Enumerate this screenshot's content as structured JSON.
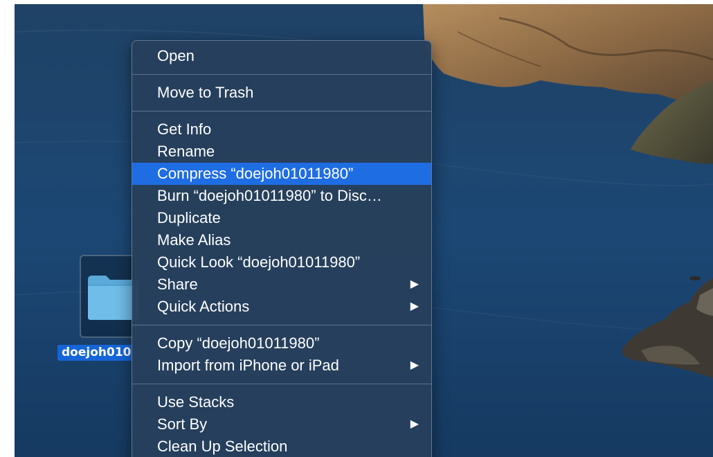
{
  "desktop": {
    "folder": {
      "label": "doejoh010",
      "icon": "folder-icon"
    }
  },
  "context_menu": {
    "groups": [
      {
        "items": [
          {
            "label": "Open"
          }
        ]
      },
      {
        "items": [
          {
            "label": "Move to Trash"
          }
        ]
      },
      {
        "items": [
          {
            "label": "Get Info"
          },
          {
            "label": "Rename"
          },
          {
            "label": "Compress “doejoh01011980”",
            "highlighted": true
          },
          {
            "label": "Burn “doejoh01011980” to Disc…"
          },
          {
            "label": "Duplicate"
          },
          {
            "label": "Make Alias"
          },
          {
            "label": "Quick Look “doejoh01011980”"
          },
          {
            "label": "Share",
            "submenu": true,
            "arrow": "▶"
          },
          {
            "label": "Quick Actions",
            "submenu": true,
            "arrow": "▶"
          }
        ]
      },
      {
        "items": [
          {
            "label": "Copy “doejoh01011980”"
          },
          {
            "label": "Import from iPhone or iPad",
            "submenu": true,
            "arrow": "▶"
          }
        ]
      },
      {
        "items": [
          {
            "label": "Use Stacks"
          },
          {
            "label": "Sort By",
            "submenu": true,
            "arrow": "▶"
          },
          {
            "label": "Clean Up Selection"
          }
        ]
      }
    ]
  },
  "colors": {
    "highlight": "#1f6de2",
    "menu_background": "#263f5c",
    "selection_label": "#1665d8"
  }
}
